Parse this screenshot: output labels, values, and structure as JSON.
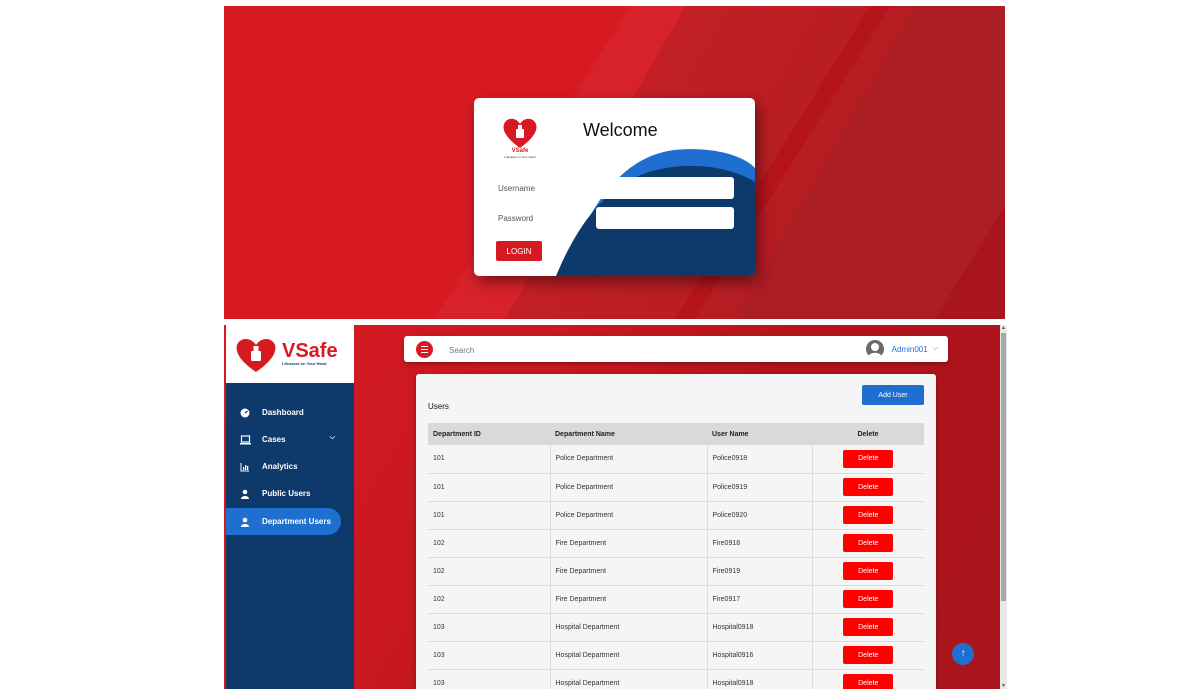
{
  "login": {
    "welcome": "Welcome",
    "logo_brand": "VSafe",
    "logo_tagline": "Lifesaver on Your Hand",
    "username_label": "Username",
    "password_label": "Password",
    "login_button": "LOGIN"
  },
  "admin": {
    "brand": "VSafe",
    "tagline": "Lifesaver on Your Hand",
    "search_placeholder": "Search",
    "user_name": "Admin001",
    "sidebar": [
      {
        "label": "Dashboard",
        "icon": "dashboard-icon"
      },
      {
        "label": "Cases",
        "icon": "laptop-icon"
      },
      {
        "label": "Analytics",
        "icon": "chart-icon"
      },
      {
        "label": "Public Users",
        "icon": "user-icon"
      },
      {
        "label": "Department Users",
        "icon": "user-icon"
      }
    ],
    "panel_title": "Users",
    "add_user": "Add User",
    "columns": [
      "Department ID",
      "Department Name",
      "User Name",
      "Delete"
    ],
    "rows": [
      {
        "id": "101",
        "dept": "Police Department",
        "user": "Police0918",
        "action": "Delete"
      },
      {
        "id": "101",
        "dept": "Police Department",
        "user": "Police0919",
        "action": "Delete"
      },
      {
        "id": "101",
        "dept": "Police Department",
        "user": "Police0920",
        "action": "Delete"
      },
      {
        "id": "102",
        "dept": "Fire Department",
        "user": "Fire0918",
        "action": "Delete"
      },
      {
        "id": "102",
        "dept": "Fire Department",
        "user": "Fire0919",
        "action": "Delete"
      },
      {
        "id": "102",
        "dept": "Fire Department",
        "user": "Fire0917",
        "action": "Delete"
      },
      {
        "id": "103",
        "dept": "Hospital Department",
        "user": "Hospital0918",
        "action": "Delete"
      },
      {
        "id": "103",
        "dept": "Hospital Department",
        "user": "Hospital0916",
        "action": "Delete"
      },
      {
        "id": "103",
        "dept": "Hospital Department",
        "user": "Hospital0918",
        "action": "Delete"
      }
    ]
  },
  "colors": {
    "brand_red": "#d71a21",
    "navy": "#0d3a6b",
    "accent_blue": "#1f6fd0",
    "delete_red": "#ff0000"
  }
}
